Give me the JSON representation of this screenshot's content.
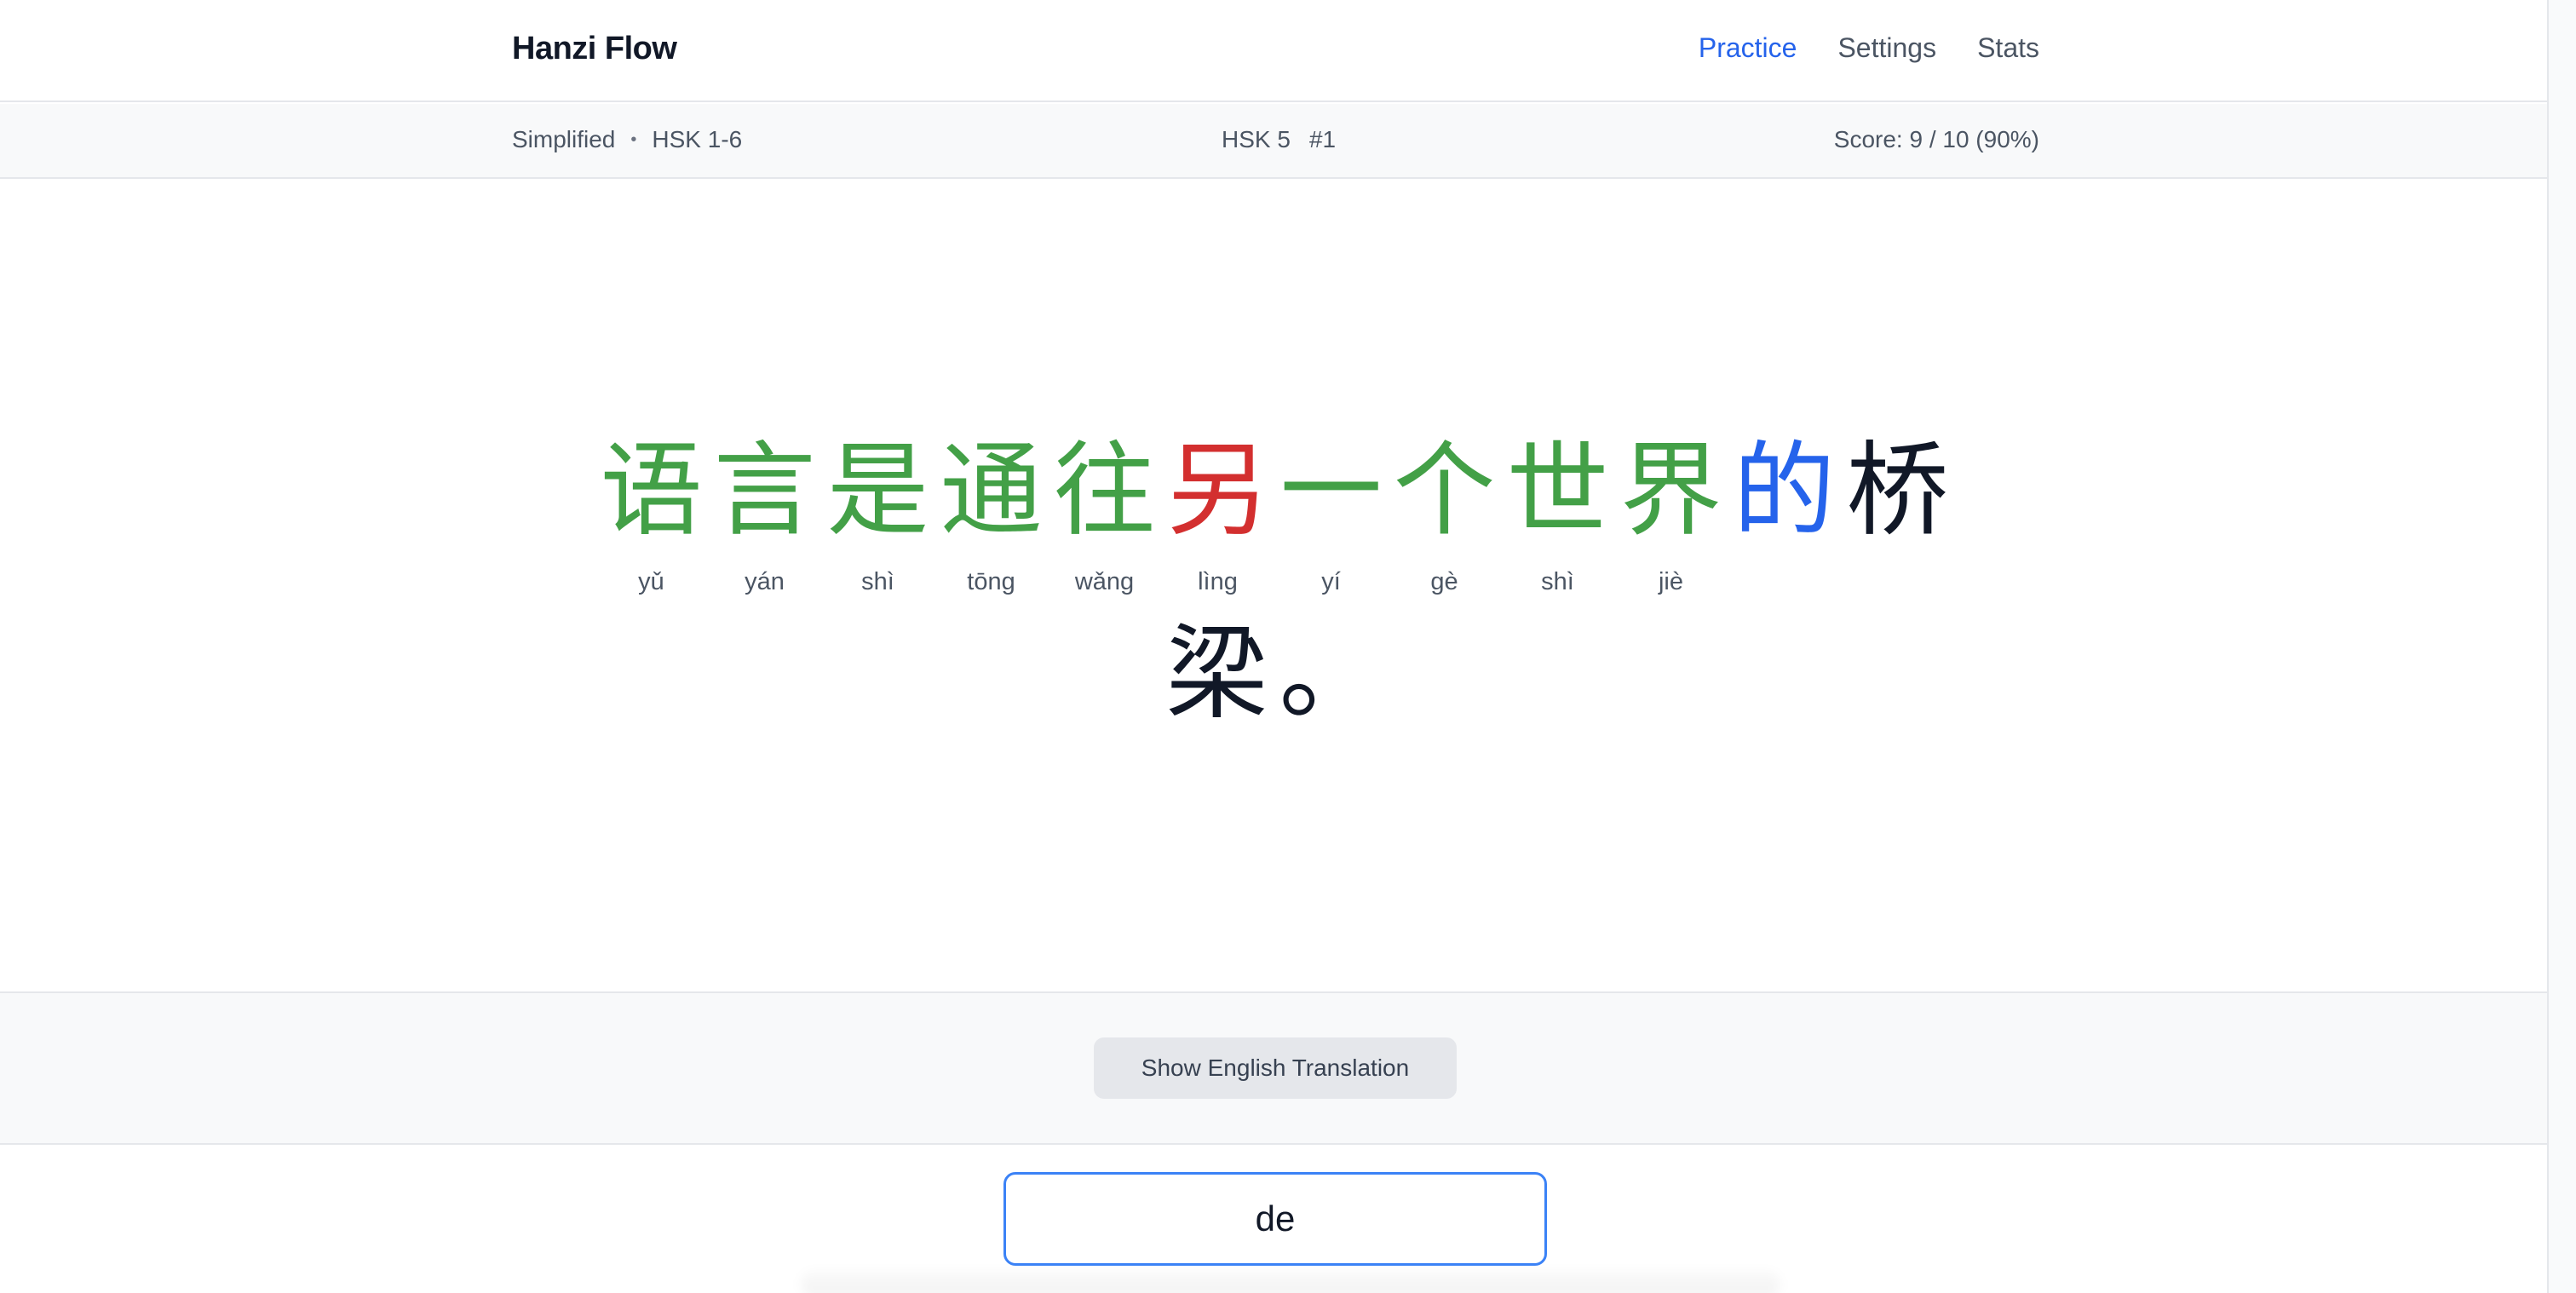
{
  "app": {
    "title": "Hanzi Flow"
  },
  "nav": {
    "items": [
      {
        "label": "Practice",
        "active": true
      },
      {
        "label": "Settings",
        "active": false
      },
      {
        "label": "Stats",
        "active": false
      }
    ]
  },
  "status": {
    "script": "Simplified",
    "separator": "•",
    "level_range": "HSK 1-6",
    "current_level": "HSK 5",
    "item_number": "#1",
    "score": "Score: 9 / 10 (90%)"
  },
  "sentence": {
    "line1": [
      {
        "char": "语",
        "pinyin": "yǔ",
        "state": "correct"
      },
      {
        "char": "言",
        "pinyin": "yán",
        "state": "correct"
      },
      {
        "char": "是",
        "pinyin": "shì",
        "state": "correct"
      },
      {
        "char": "通",
        "pinyin": "tōng",
        "state": "correct"
      },
      {
        "char": "往",
        "pinyin": "wǎng",
        "state": "correct"
      },
      {
        "char": "另",
        "pinyin": "lìng",
        "state": "wrong"
      },
      {
        "char": "一",
        "pinyin": "yí",
        "state": "correct"
      },
      {
        "char": "个",
        "pinyin": "gè",
        "state": "correct"
      },
      {
        "char": "世",
        "pinyin": "shì",
        "state": "correct"
      },
      {
        "char": "界",
        "pinyin": "jiè",
        "state": "correct"
      },
      {
        "char": "的",
        "pinyin": "",
        "state": "current"
      },
      {
        "char": "桥",
        "pinyin": "",
        "state": "pending"
      }
    ],
    "line2": [
      {
        "char": "梁",
        "pinyin": "",
        "state": "pending"
      },
      {
        "char": "。",
        "pinyin": "",
        "state": "pending"
      }
    ]
  },
  "colors": {
    "correct": "#43a047",
    "wrong": "#d32f2f",
    "current": "#2563eb",
    "pending": "#111827",
    "accent": "#2563eb"
  },
  "translation": {
    "button_label": "Show English Translation"
  },
  "answer": {
    "value": "de"
  }
}
